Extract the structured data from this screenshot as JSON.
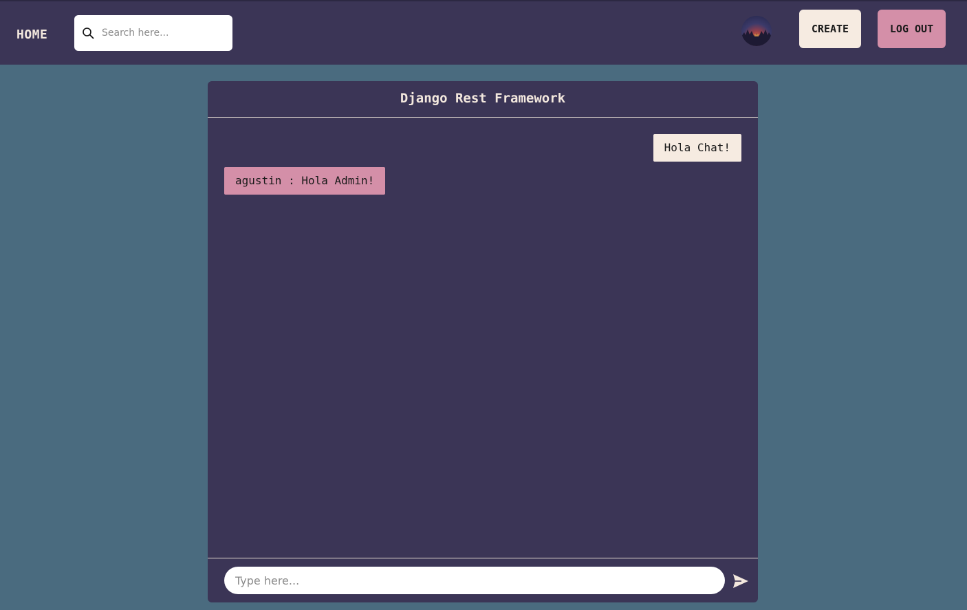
{
  "nav": {
    "home_label": "HOME",
    "search_placeholder": "Search here...",
    "avatar_icon": "avatar-sunset-image",
    "create_label": "CREATE",
    "logout_label": "LOG OUT"
  },
  "chat": {
    "title": "Django Rest Framework",
    "messages": [
      {
        "direction": "outgoing",
        "text": "Hola Chat!"
      },
      {
        "direction": "incoming",
        "text": "agustin : Hola Admin!"
      }
    ],
    "input_placeholder": "Type here...",
    "send_icon": "send-icon"
  },
  "colors": {
    "page_bg": "#4a6b7f",
    "nav_bg": "#3b3556",
    "panel_bg": "#3b3556",
    "cream": "#f6ebe1",
    "pink": "#d48fa8"
  }
}
